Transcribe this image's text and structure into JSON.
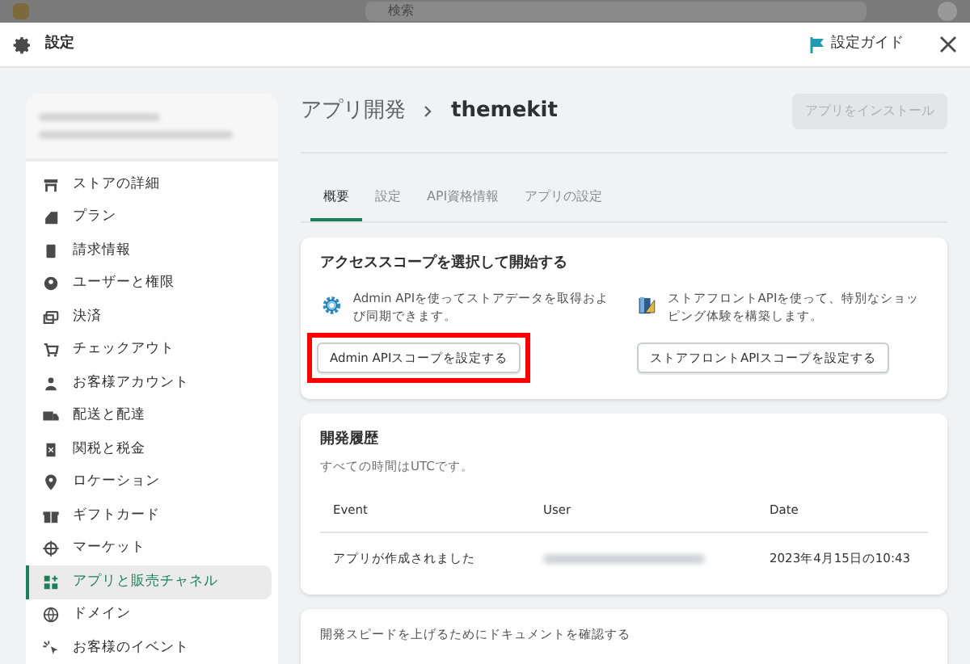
{
  "backdrop": {
    "search": {
      "placeholder": "検索"
    }
  },
  "header": {
    "title": "設定",
    "guide": "設定ガイド"
  },
  "sidebar": {
    "items": [
      {
        "label": "ストアの詳細",
        "selected": false
      },
      {
        "label": "プラン",
        "selected": false
      },
      {
        "label": "請求情報",
        "selected": false
      },
      {
        "label": "ユーザーと権限",
        "selected": false
      },
      {
        "label": "決済",
        "selected": false
      },
      {
        "label": "チェックアウト",
        "selected": false
      },
      {
        "label": "お客様アカウント",
        "selected": false
      },
      {
        "label": "配送と配達",
        "selected": false
      },
      {
        "label": "関税と税金",
        "selected": false
      },
      {
        "label": "ロケーション",
        "selected": false
      },
      {
        "label": "ギフトカード",
        "selected": false
      },
      {
        "label": "マーケット",
        "selected": false
      },
      {
        "label": "アプリと販売チャネル",
        "selected": true
      },
      {
        "label": "ドメイン",
        "selected": false
      },
      {
        "label": "お客様のイベント",
        "selected": false
      }
    ]
  },
  "page": {
    "breadcrumb": "アプリ開発",
    "title": "themekit",
    "install_button": {
      "label": "アプリをインストール",
      "disabled": true
    }
  },
  "tabs": [
    {
      "label": "概要",
      "selected": true
    },
    {
      "label": "設定",
      "selected": false
    },
    {
      "label": "API資格情報",
      "selected": false
    },
    {
      "label": "アプリの設定",
      "selected": false
    }
  ],
  "scopes_card": {
    "title": "アクセススコープを選択して開始する",
    "options": [
      {
        "text": "Admin APIを使ってストアデータを取得および同期できます。",
        "button": "Admin APIスコープを設定する",
        "highlighted": true
      },
      {
        "text": "ストアフロントAPIを使って、特別なショッピング体験を構築します。",
        "button": "ストアフロントAPIスコープを設定する",
        "highlighted": false
      }
    ]
  },
  "history_card": {
    "title": "開発履歴",
    "subtitle": "すべての時間はUTCです。",
    "columns": [
      "Event",
      "User",
      "Date"
    ],
    "rows": [
      {
        "event": "アプリが作成されました",
        "date": "2023年4月15日の10:43"
      }
    ]
  },
  "docs_card": {
    "title": "開発スピードを上げるためにドキュメントを確認する"
  }
}
